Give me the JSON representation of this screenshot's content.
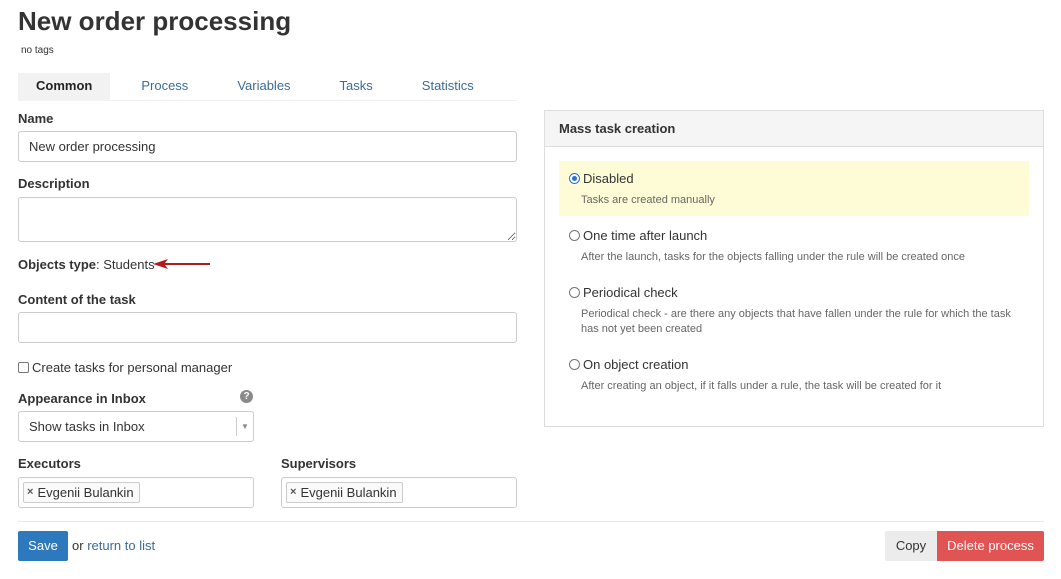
{
  "page": {
    "title": "New order processing",
    "tags": "no tags"
  },
  "tabs": [
    {
      "label": "Common"
    },
    {
      "label": "Process"
    },
    {
      "label": "Variables"
    },
    {
      "label": "Tasks"
    },
    {
      "label": "Statistics"
    }
  ],
  "form": {
    "name_label": "Name",
    "name_value": "New order processing",
    "description_label": "Description",
    "description_value": "",
    "objects_type_label": "Objects type",
    "objects_type_value": ": Students",
    "content_label": "Content of the task",
    "content_value": "",
    "personal_manager_label": "Create tasks for personal manager",
    "appearance_label": "Appearance in Inbox",
    "appearance_value": "Show tasks in Inbox",
    "executors_label": "Executors",
    "executors": [
      "Evgenii Bulankin"
    ],
    "supervisors_label": "Supervisors",
    "supervisors": [
      "Evgenii Bulankin"
    ],
    "token_remove": "×"
  },
  "mass_task": {
    "header": "Mass task creation",
    "options": [
      {
        "title": "Disabled",
        "desc": "Tasks are created manually"
      },
      {
        "title": "One time after launch",
        "desc": "After the launch, tasks for the objects falling under the rule will be created once"
      },
      {
        "title": "Periodical check",
        "desc": "Periodical check - are there any objects that have fallen under the rule for which the task has not yet been created"
      },
      {
        "title": "On object creation",
        "desc": "After creating an object, if it falls under a rule, the task will be created for it"
      }
    ],
    "selected": "Disabled"
  },
  "footer": {
    "save_label": "Save",
    "or_text": "or",
    "return_label": "return to list",
    "copy_label": "Copy",
    "delete_label": "Delete process"
  },
  "colors": {
    "primary": "#2e78be",
    "danger": "#e05454",
    "link": "#3d6b96",
    "selected_bg": "#fdfcd6",
    "arrow": "#b01c1c"
  },
  "icons": {
    "help": "question-circle-icon",
    "dropdown": "chevron-down-icon",
    "arrow": "arrow-left-icon",
    "remove": "close-icon"
  }
}
